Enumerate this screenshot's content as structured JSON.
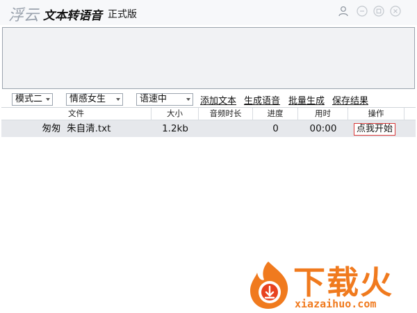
{
  "app": {
    "name": "浮云",
    "subtitle": "文本转语音",
    "edition": "正式版"
  },
  "window_controls": [
    "user-icon",
    "minimize-icon",
    "maximize-icon",
    "close-icon"
  ],
  "toolbar": {
    "mode": "模式二",
    "emotion": "情感女生",
    "speed": "语速中",
    "add_text": "添加文本",
    "generate_voice": "生成语音",
    "batch_generate": "批量生成",
    "save_result": "保存结果"
  },
  "table": {
    "headers": [
      "文件",
      "大小",
      "音频时长",
      "进度",
      "用时",
      "操作"
    ],
    "rows": [
      {
        "file": "匆匆  朱自清.txt",
        "size": "1.2kb",
        "duration": "",
        "progress": "0",
        "elapsed": "00:00",
        "action": "点我开始"
      }
    ]
  },
  "watermark": {
    "text": "下载火",
    "url": "xiazaihuo.com"
  },
  "colors": {
    "accent_red": "#d93a3a",
    "watermark_orange": "#f07a1e",
    "row_selected": "#e6e8ec"
  }
}
